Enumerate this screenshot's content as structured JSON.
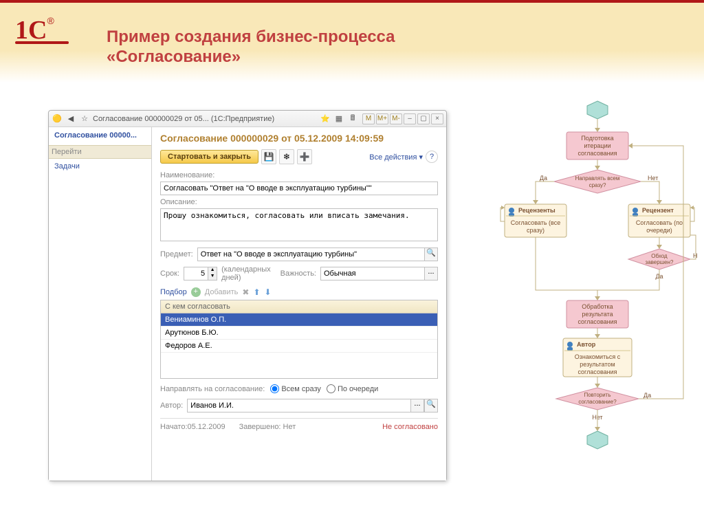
{
  "banner": {
    "title_line1": "Пример создания бизнес-процесса",
    "title_line2": "«Согласование»"
  },
  "window": {
    "title": "Согласование 000000029 от 05...  (1С:Предприятие)",
    "tb_buttons": [
      "M",
      "M+",
      "M-"
    ],
    "nav": {
      "title": "Согласование 00000...",
      "section": "Перейти",
      "link": "Задачи"
    },
    "form": {
      "title": "Согласование 000000029 от 05.12.2009 14:09:59",
      "btn_start": "Стартовать и закрыть",
      "actions": "Все действия",
      "fields": {
        "name_lbl": "Наименование:",
        "name_val": "Согласовать \"Ответ на \"О вводе в эксплуатацию турбины\"\"",
        "desc_lbl": "Описание:",
        "desc_val": "Прошу ознакомиться, согласовать или вписать замечания.",
        "subject_lbl": "Предмет:",
        "subject_val": "Ответ на \"О вводе в эксплуатацию турбины\"",
        "deadline_lbl": "Срок:",
        "deadline_val": "5",
        "deadline_unit": "(календарных дней)",
        "priority_lbl": "Важность:",
        "priority_val": "Обычная"
      },
      "table": {
        "tools": {
          "pick": "Подбор",
          "add": "Добавить"
        },
        "header": "С кем согласовать",
        "rows": [
          "Вениаминов О.П.",
          "Арутюнов Б.Ю.",
          "Федоров А.Е."
        ]
      },
      "route": {
        "label": "Направлять на согласование:",
        "opt1": "Всем сразу",
        "opt2": "По очереди"
      },
      "author": {
        "label": "Автор:",
        "value": "Иванов И.И."
      },
      "status": {
        "started": "Начато:05.12.2009",
        "finished": "Завершено: Нет",
        "result": "Не согласовано"
      }
    }
  },
  "flow": {
    "n1": {
      "t": "Подготовка",
      "l2": "итерации",
      "l3": "согласования"
    },
    "d1": "Направлять всем\nсразу?",
    "yes": "Да",
    "no": "Нет",
    "n2": {
      "role": "Рецензенты",
      "t": "Согласовать (все",
      "l2": "сразу)"
    },
    "n3": {
      "role": "Рецензент",
      "t": "Согласовать (по",
      "l2": "очереди)"
    },
    "d2": "Обход\nзавершен?",
    "n4": {
      "t": "Обработка",
      "l2": "результата",
      "l3": "согласования"
    },
    "n5": {
      "role": "Автор",
      "t": "Ознакомиться с",
      "l2": "результатом",
      "l3": "согласования"
    },
    "d3": "Повторить\nсогласование?"
  }
}
